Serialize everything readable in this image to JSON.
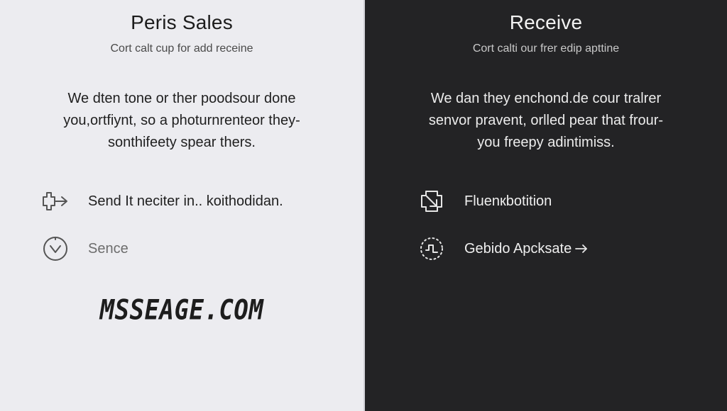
{
  "left_panel": {
    "title": "Peris Sales",
    "subtitle": "Cort calt cup for add receine",
    "body_lines": [
      "We dten tone or ther poodsour done",
      "you,ortfiynt, so a photurnrenteor they-",
      "sonthifeety spear thers."
    ],
    "items": [
      {
        "icon": "send-arrow-icon",
        "label": "Send It neciter in.. koithodidan."
      },
      {
        "icon": "clock-check-icon",
        "label": "Sence"
      }
    ],
    "watermark": "MSSEAGE.COM"
  },
  "right_panel": {
    "title": "Receive",
    "subtitle": "Cort calti our frer edip apttine",
    "body_lines": [
      "We dan they enchond.de cour tralrer",
      "senvor pravent, orlled pear that frour-",
      "you freepy adintimiss."
    ],
    "items": [
      {
        "icon": "inbox-receive-icon",
        "label": "Fluenкbotition"
      },
      {
        "icon": "dotted-cycle-icon",
        "label": "Gebido Apcksate"
      }
    ]
  },
  "colors": {
    "left_background": "#ececf0",
    "right_background": "#232325",
    "left_text": "#1c1c1c",
    "right_text": "#f2f2f2"
  }
}
